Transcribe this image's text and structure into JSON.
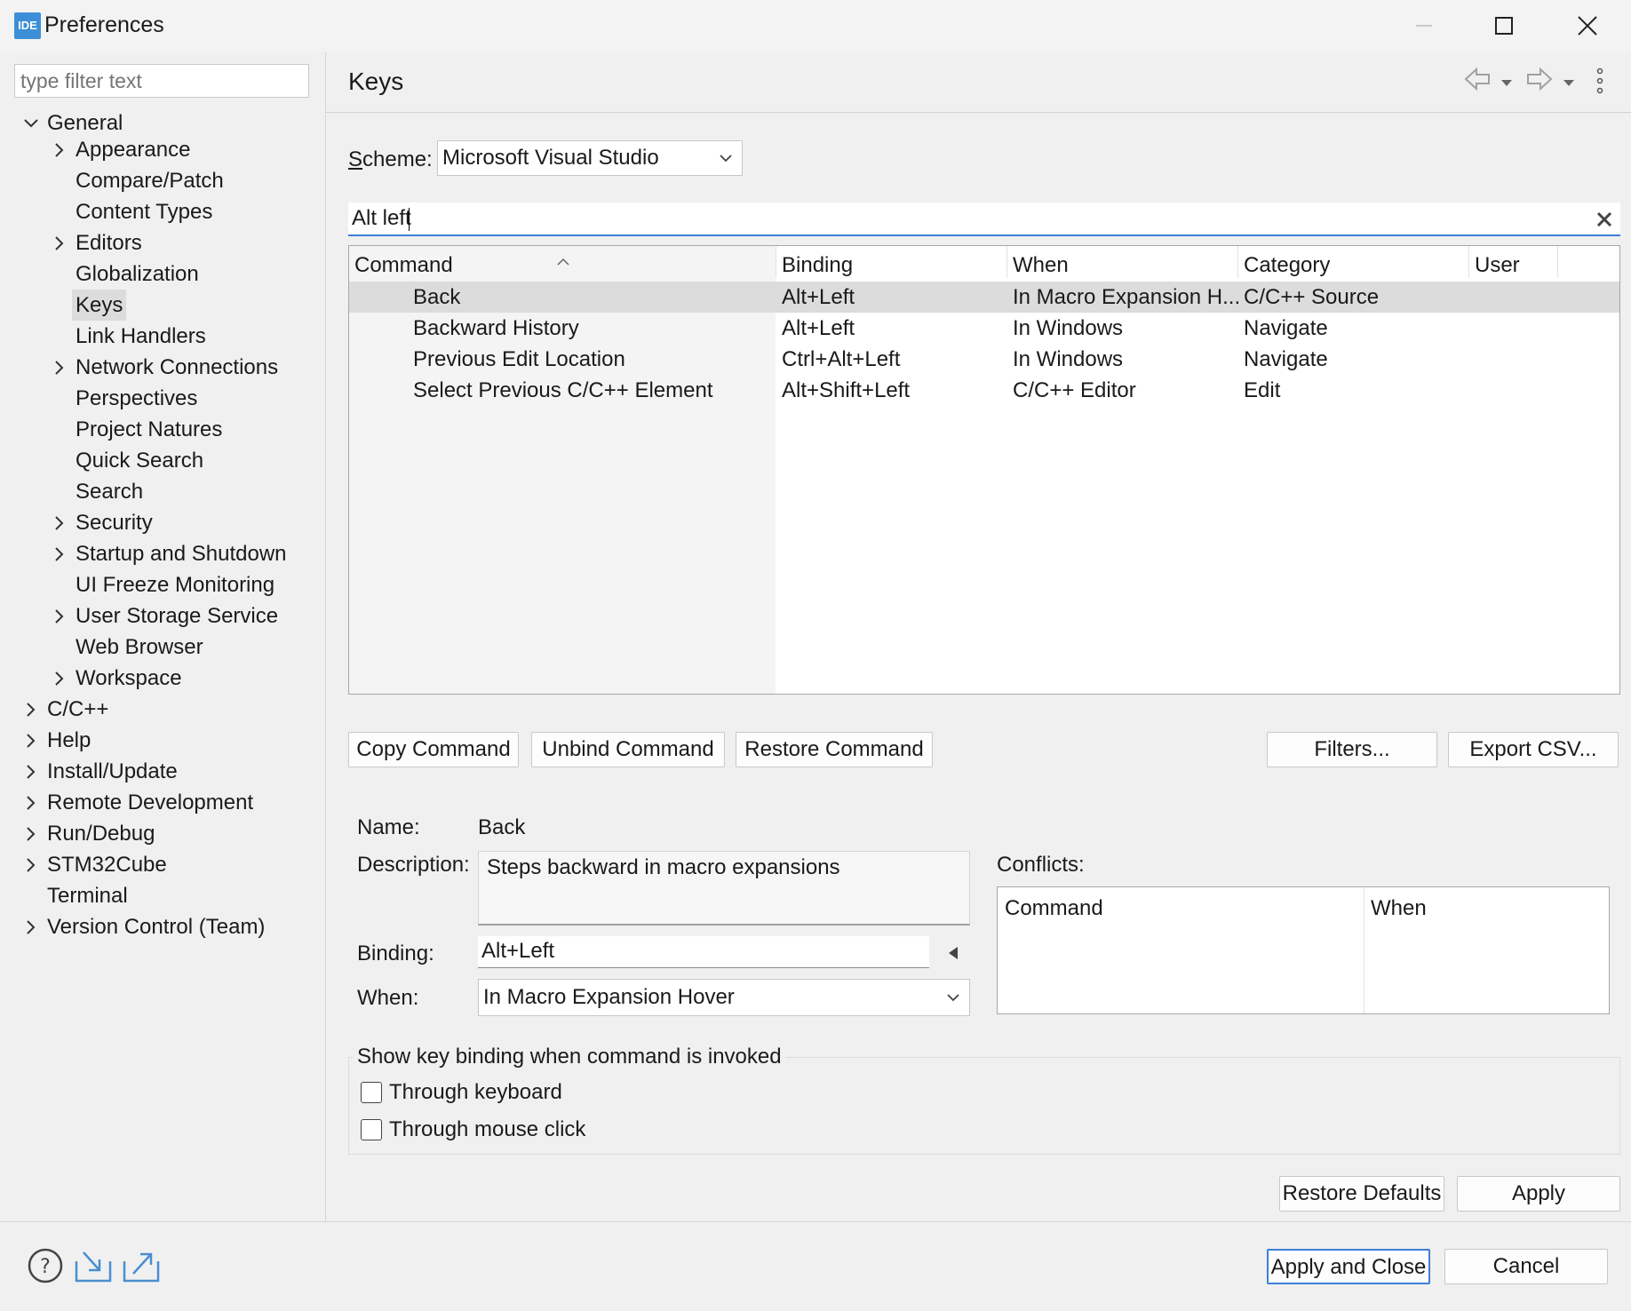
{
  "window": {
    "app_icon_text": "IDE",
    "title": "Preferences"
  },
  "filter": {
    "placeholder": "type filter text"
  },
  "tree": {
    "general": "General",
    "general_children": [
      "Appearance",
      "Compare/Patch",
      "Content Types",
      "Editors",
      "Globalization",
      "Keys",
      "Link Handlers",
      "Network Connections",
      "Perspectives",
      "Project Natures",
      "Quick Search",
      "Search",
      "Security",
      "Startup and Shutdown",
      "UI Freeze Monitoring",
      "User Storage Service",
      "Web Browser",
      "Workspace"
    ],
    "top_level": [
      "C/C++",
      "Help",
      "Install/Update",
      "Remote Development",
      "Run/Debug",
      "STM32Cube",
      "Terminal",
      "Version Control (Team)"
    ]
  },
  "page": {
    "title": "Keys"
  },
  "scheme": {
    "label_prefix": "S",
    "label_rest": "cheme:",
    "value": "Microsoft Visual Studio"
  },
  "search": {
    "value": "Alt left"
  },
  "table": {
    "headers": [
      "Command",
      "Binding",
      "When",
      "Category",
      "User"
    ],
    "rows": [
      [
        "Back",
        "Alt+Left",
        "In Macro Expansion H...",
        "C/C++ Source",
        ""
      ],
      [
        "Backward History",
        "Alt+Left",
        "In Windows",
        "Navigate",
        ""
      ],
      [
        "Previous Edit Location",
        "Ctrl+Alt+Left",
        "In Windows",
        "Navigate",
        ""
      ],
      [
        "Select Previous C/C++ Element",
        "Alt+Shift+Left",
        "C/C++ Editor",
        "Edit",
        ""
      ]
    ]
  },
  "buttons": {
    "copy_command": "Copy Command",
    "unbind_command": "Unbind Command",
    "restore_command": "Restore Command",
    "filters": "Filters...",
    "export_csv": "Export CSV...",
    "restore_defaults": "Restore Defaults",
    "apply": "Apply",
    "apply_and_close": "Apply and Close",
    "cancel": "Cancel"
  },
  "details": {
    "name_label": "Name:",
    "name_value": "Back",
    "description_label": "Description:",
    "description_value": "Steps backward in macro expansions",
    "binding_label": "Binding:",
    "binding_value": "Alt+Left",
    "when_label": "When:",
    "when_value": "In Macro Expansion Hover",
    "conflicts_label": "Conflicts:",
    "conflicts_headers": [
      "Command",
      "When"
    ]
  },
  "show_binding": {
    "group_label": "Show key binding when command is invoked",
    "through_keyboard": "Through keyboard",
    "through_mouse": "Through mouse click"
  }
}
